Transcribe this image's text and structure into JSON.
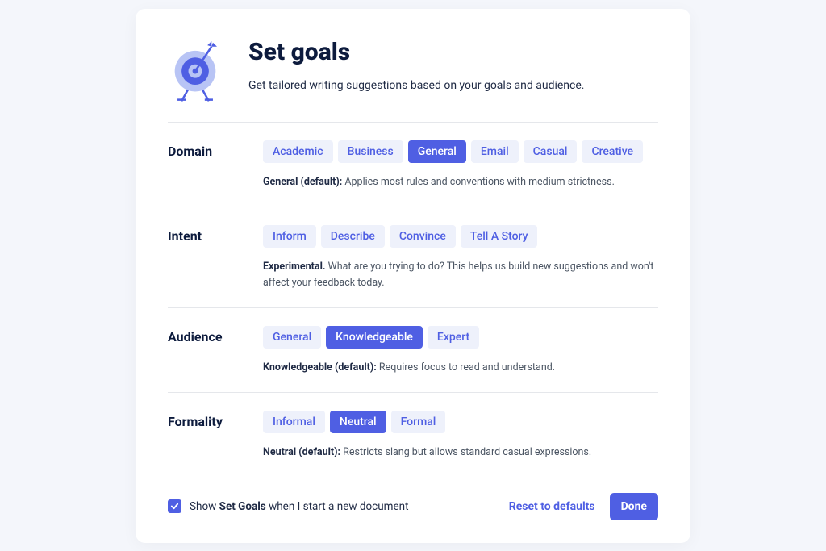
{
  "header": {
    "title": "Set goals",
    "subtitle": "Get tailored writing suggestions based on your goals and audience."
  },
  "domain": {
    "label": "Domain",
    "options": [
      "Academic",
      "Business",
      "General",
      "Email",
      "Casual",
      "Creative"
    ],
    "active": 2,
    "desc_bold": "General (default):",
    "desc": " Applies most rules and conventions with medium strictness."
  },
  "intent": {
    "label": "Intent",
    "options": [
      "Inform",
      "Describe",
      "Convince",
      "Tell A Story"
    ],
    "active": -1,
    "desc_bold": "Experimental.",
    "desc": " What are you trying to do? This helps us build new suggestions and won't affect your feedback today."
  },
  "audience": {
    "label": "Audience",
    "options": [
      "General",
      "Knowledgeable",
      "Expert"
    ],
    "active": 1,
    "desc_bold": "Knowledgeable (default):",
    "desc": " Requires focus to read and understand."
  },
  "formality": {
    "label": "Formality",
    "options": [
      "Informal",
      "Neutral",
      "Formal"
    ],
    "active": 1,
    "desc_bold": "Neutral (default):",
    "desc": " Restricts slang but allows standard casual expressions."
  },
  "footer": {
    "show_prefix": "Show ",
    "show_bold": "Set Goals",
    "show_suffix": " when I start a new document",
    "reset": "Reset to defaults",
    "done": "Done"
  }
}
